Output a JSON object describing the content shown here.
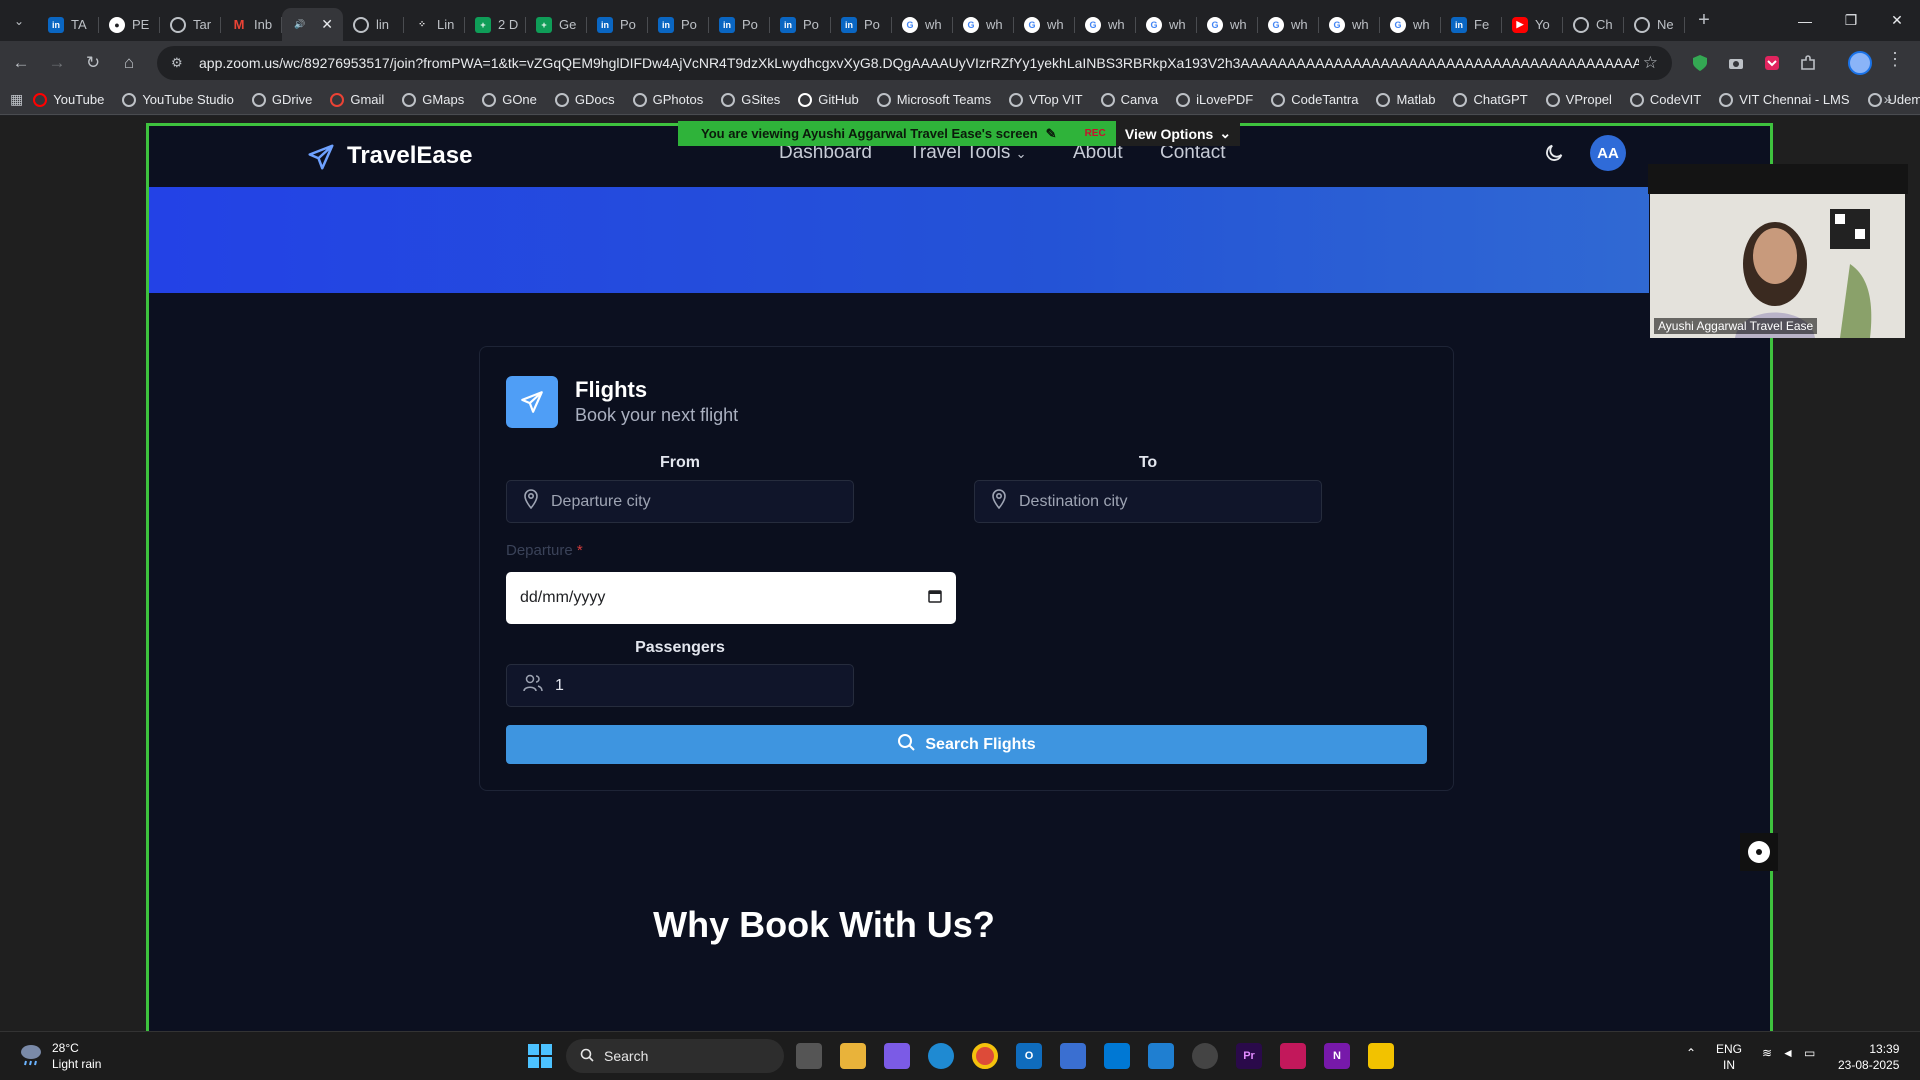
{
  "browser": {
    "tabs": [
      {
        "label": "TA",
        "favicon": "linkedin-icon"
      },
      {
        "label": "PE",
        "favicon": "github-icon"
      },
      {
        "label": "Tar",
        "favicon": "globe-icon"
      },
      {
        "label": "Inb",
        "favicon": "gmail-icon"
      },
      {
        "label": "",
        "favicon": "speaker-icon",
        "active": true
      },
      {
        "label": "lin",
        "favicon": "globe-icon"
      },
      {
        "label": "Lin",
        "favicon": "dots-icon"
      },
      {
        "label": "2 D",
        "favicon": "sheets-icon"
      },
      {
        "label": "Ge",
        "favicon": "sheets-icon"
      },
      {
        "label": "Po",
        "favicon": "linkedin-icon"
      },
      {
        "label": "Po",
        "favicon": "linkedin-icon"
      },
      {
        "label": "Po",
        "favicon": "linkedin-icon"
      },
      {
        "label": "Po",
        "favicon": "linkedin-icon"
      },
      {
        "label": "Po",
        "favicon": "linkedin-icon"
      },
      {
        "label": "wh",
        "favicon": "google-icon"
      },
      {
        "label": "wh",
        "favicon": "google-icon"
      },
      {
        "label": "wh",
        "favicon": "google-icon"
      },
      {
        "label": "wh",
        "favicon": "google-icon"
      },
      {
        "label": "wh",
        "favicon": "google-icon"
      },
      {
        "label": "wh",
        "favicon": "google-icon"
      },
      {
        "label": "wh",
        "favicon": "google-icon"
      },
      {
        "label": "wh",
        "favicon": "google-icon"
      },
      {
        "label": "wh",
        "favicon": "google-icon"
      },
      {
        "label": "Fe",
        "favicon": "linkedin-icon"
      },
      {
        "label": "Yo",
        "favicon": "youtube-icon"
      },
      {
        "label": "Ch",
        "favicon": "chatgpt-icon"
      },
      {
        "label": "Ne",
        "favicon": "chatgpt-icon"
      }
    ],
    "url": "app.zoom.us/wc/89276953517/join?fromPWA=1&tk=vZGqQEM9hglDIFDw4AjVcNR4T9dzXkLwydhcgxvXyG8.DQgAAAAUyVIzrRZfYy1yekhLaINBS3RBRkpXa193V2h3AAAAAAAAAAAAAAAAAAAAAAAAAAAAAAAAAAAAAAAAAAAAAAAAAAAA&_x_zm_r...",
    "bookmarks": [
      "YouTube",
      "YouTube Studio",
      "GDrive",
      "Gmail",
      "GMaps",
      "GOne",
      "GDocs",
      "GPhotos",
      "GSites",
      "GitHub",
      "Microsoft Teams",
      "VTop VIT",
      "Canva",
      "iLovePDF",
      "CodeTantra",
      "Matlab",
      "ChatGPT",
      "VPropel",
      "CodeVIT",
      "VIT Chennai - LMS",
      "Udemy"
    ]
  },
  "zoom": {
    "banner_text": "You are viewing  Ayushi Aggarwal Travel Ease's screen",
    "rec_label": "REC",
    "view_options_label": "View Options",
    "participant_name": "Ayushi Aggarwal Travel Ease"
  },
  "site": {
    "brand": "TravelEase",
    "nav": [
      "Dashboard",
      "Travel Tools",
      "About",
      "Contact"
    ],
    "avatar_initials": "AA",
    "card": {
      "title": "Flights",
      "subtitle": "Book your next flight",
      "from_label": "From",
      "from_placeholder": "Departure city",
      "to_label": "To",
      "to_placeholder": "Destination city",
      "departure_label": "Departure",
      "required_mark": "*",
      "date_placeholder": "dd/mm/yyyy",
      "passengers_label": "Passengers",
      "passengers_value": "1",
      "search_label": "Search Flights"
    },
    "why_heading": "Why Book With Us?"
  },
  "taskbar": {
    "weather_temp": "28°C",
    "weather_desc": "Light rain",
    "search_placeholder": "Search",
    "lang_top": "ENG",
    "lang_bottom": "IN",
    "time": "13:39",
    "date": "23-08-2025"
  },
  "colors": {
    "accent_blue": "#3e95e0",
    "share_border": "#3ec23e",
    "hero_blue": "#2453d6"
  }
}
